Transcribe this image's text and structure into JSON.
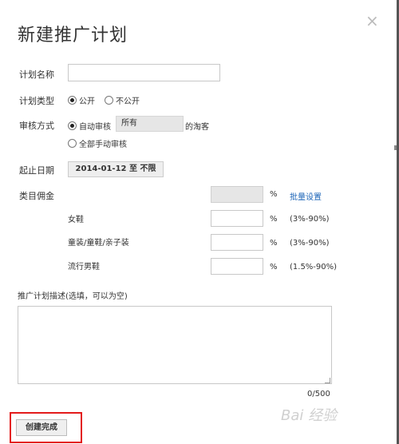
{
  "dialog": {
    "title": "新建推广计划",
    "close_icon": "×"
  },
  "form": {
    "plan_name": {
      "label": "计划名称",
      "value": "",
      "placeholder": ""
    },
    "plan_type": {
      "label": "计划类型",
      "options": [
        {
          "label": "公开",
          "checked": true
        },
        {
          "label": "不公开",
          "checked": false
        }
      ]
    },
    "review": {
      "label": "审核方式",
      "auto_label": "自动审核",
      "auto_checked": true,
      "select_value": "所有",
      "suffix": "的淘客",
      "manual_label": "全部手动审核",
      "manual_checked": false
    },
    "date": {
      "label": "起止日期",
      "value": "2014-01-12 至 不限"
    },
    "commission": {
      "label": "类目佣金",
      "batch_pct": "%",
      "batch_link": "批量设置",
      "rows": [
        {
          "name": "女鞋",
          "pct": "%",
          "range": "(3%-90%)"
        },
        {
          "name": "童装/童鞋/亲子装",
          "pct": "%",
          "range": "(3%-90%)"
        },
        {
          "name": "流行男鞋",
          "pct": "%",
          "range": "(1.5%-90%)"
        }
      ]
    },
    "description": {
      "label": "推广计划描述(选填，可以为空)",
      "value": "",
      "counter": "0/500"
    }
  },
  "actions": {
    "create_label": "创建完成"
  },
  "watermark": "Bai 经验"
}
